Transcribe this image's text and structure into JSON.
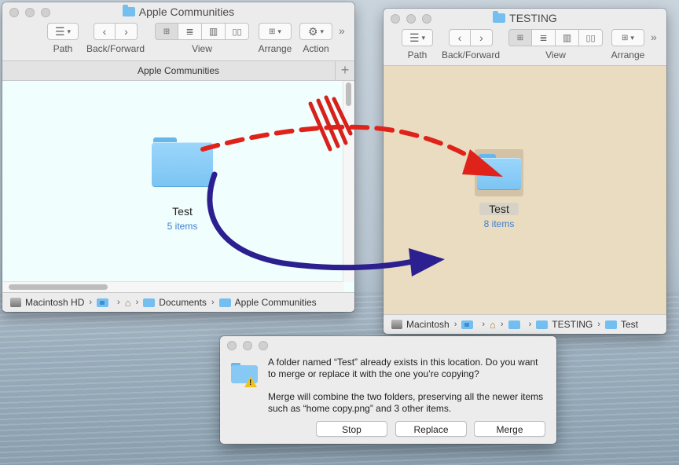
{
  "windows": {
    "left": {
      "title": "Apple Communities",
      "tab_label": "Apple Communities",
      "toolbar": {
        "path_label": "Path",
        "backforward_label": "Back/Forward",
        "view_label": "View",
        "arrange_label": "Arrange",
        "action_label": "Action"
      },
      "folder": {
        "name": "Test",
        "count": "5 items"
      },
      "path": [
        "Macintosh HD",
        "Documents",
        "Apple Communities"
      ],
      "background": "#f0fefd"
    },
    "right": {
      "title": "TESTING",
      "toolbar": {
        "path_label": "Path",
        "backforward_label": "Back/Forward",
        "view_label": "View",
        "arrange_label": "Arrange"
      },
      "folder": {
        "name": "Test",
        "count": "8 items"
      },
      "path": [
        "Macintosh",
        "TESTING",
        "Test"
      ],
      "background": "#eadcc0"
    }
  },
  "dialog": {
    "message": "A folder named “Test” already exists in this location. Do you want to merge or replace it with the one you’re copying?",
    "detail": "Merge will combine the two folders, preserving all the newer items such as “home copy.png” and 3 other items.",
    "buttons": {
      "stop": "Stop",
      "replace": "Replace",
      "merge": "Merge"
    }
  },
  "annotations": {
    "blocked_arrow_color": "#e0231a",
    "merge_arrow_color": "#2c1f8f"
  },
  "icons": {
    "toolbar": [
      "list-icon",
      "chevron-left-icon",
      "chevron-right-icon",
      "icon-view-icon",
      "list-view-icon",
      "column-view-icon",
      "cover-flow-icon",
      "arrange-icon",
      "gear-icon",
      "more-icon"
    ],
    "misc": [
      "folder-icon",
      "warning-icon",
      "home-icon",
      "hard-drive-icon"
    ]
  }
}
